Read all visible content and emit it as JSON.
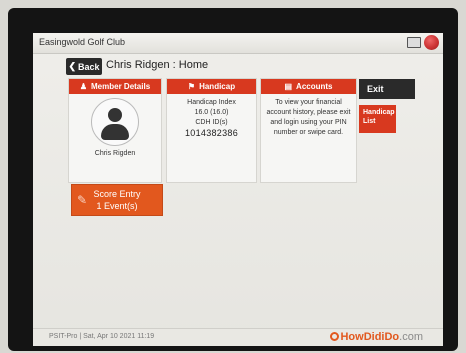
{
  "window": {
    "title": "Easingwold Golf Club"
  },
  "nav": {
    "back_label": "Back",
    "back_icon": "chevron-left-icon"
  },
  "page": {
    "title": "Chris Ridgen : Home"
  },
  "member_card": {
    "header": "Member Details",
    "header_icon": "person-icon",
    "name": "Chris Rigden"
  },
  "handicap_card": {
    "header": "Handicap",
    "header_icon": "flag-icon",
    "index_label": "Handicap Index",
    "index_value": "16.0 (16.0)",
    "cdh_label": "CDH ID(s)",
    "cdh_value": "1014382386"
  },
  "accounts_card": {
    "header": "Accounts",
    "header_icon": "card-icon",
    "line1": "To view your financial",
    "line2": "account history, please exit",
    "line3": "and login using your PIN",
    "line4": "number or swipe card."
  },
  "actions": {
    "exit_label": "Exit",
    "handicap_list_line1": "Handicap",
    "handicap_list_line2": "List"
  },
  "score_entry": {
    "line1": "Score Entry",
    "line2": "1 Event(s)"
  },
  "status": {
    "text": "PSIT-Pro  |  Sat, Apr 10 2021 11:19",
    "brand_main": "HowDidiDo",
    "brand_suffix": ".com"
  },
  "colors": {
    "accent_red": "#d8391f",
    "accent_orange": "#e2581e",
    "dark_button": "#2a2a2a"
  }
}
